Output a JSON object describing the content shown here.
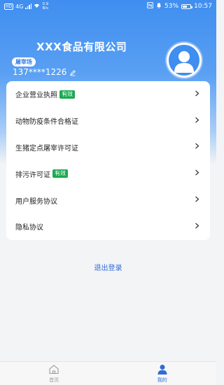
{
  "status_bar": {
    "hd_label": "HD",
    "net_label": "4G",
    "speed_value": "0.9",
    "speed_unit": "B/s",
    "battery": "53%",
    "time": "10:57"
  },
  "profile": {
    "company_name": "XXX食品有限公司",
    "role": "屠宰场",
    "phone": "137****1226"
  },
  "menu": {
    "items": [
      {
        "label": "企业营业执照",
        "tag": "有效"
      },
      {
        "label": "动物防疫条件合格证",
        "tag": ""
      },
      {
        "label": "生猪定点屠宰许可证",
        "tag": ""
      },
      {
        "label": "排污许可证",
        "tag": "有效"
      },
      {
        "label": "用户服务协议",
        "tag": ""
      },
      {
        "label": "隐私协议",
        "tag": ""
      }
    ]
  },
  "logout_label": "退出登录",
  "tabbar": {
    "home_label": "首页",
    "mine_label": "我的"
  },
  "colors": {
    "accent": "#2f6bd8",
    "valid_tag": "#1aaa4f",
    "header_top": "#3f8ef0"
  },
  "icons": [
    "signal-icon",
    "wifi-icon",
    "nfc-icon",
    "bell-icon",
    "battery-icon",
    "edit-icon",
    "avatar-icon",
    "chevron-right-icon",
    "home-icon",
    "user-icon"
  ]
}
